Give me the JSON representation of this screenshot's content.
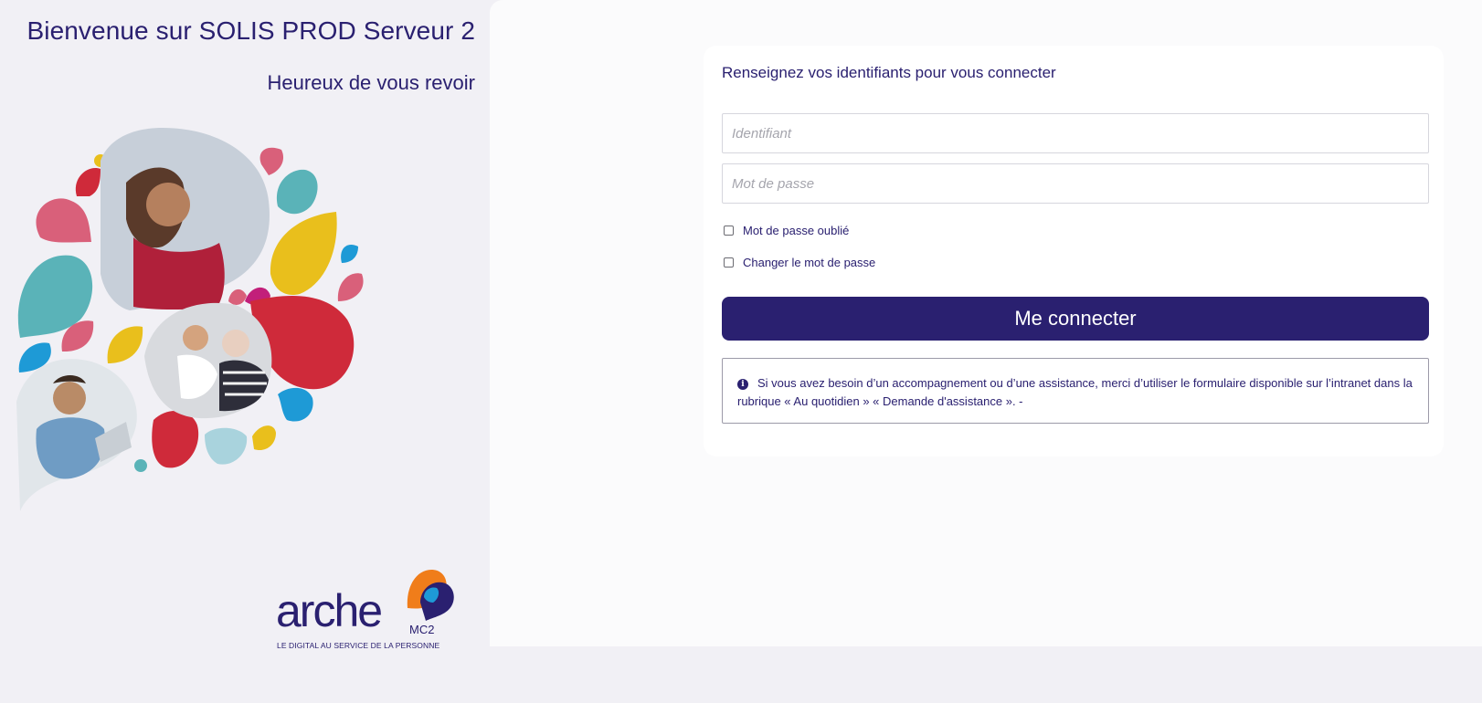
{
  "welcome": {
    "title": "Bienvenue sur SOLIS PROD Serveur 2",
    "subtitle": "Heureux de vous revoir"
  },
  "brand": {
    "logo_text": "arche",
    "logo_suffix": "MC2",
    "tagline": "LE DIGITAL AU SERVICE DE LA PERSONNE",
    "colors": {
      "primary": "#2a2070",
      "orange": "#f07d1a",
      "blue": "#1e9ad6",
      "red": "#cf2a3a",
      "pink": "#d9607a",
      "teal": "#5ab3b8",
      "yellow": "#e9bf1c"
    }
  },
  "login": {
    "heading": "Renseignez vos identifiants pour vous connecter",
    "username_placeholder": "Identifiant",
    "password_placeholder": "Mot de passe",
    "forgot_password_label": "Mot de passe oublié",
    "change_password_label": "Changer le mot de passe",
    "submit_label": "Me connecter",
    "info_icon": "info-circle-icon",
    "info_text": "Si vous avez besoin d’un accompagnement ou d’une assistance, merci d’utiliser le formulaire disponible sur l’intranet dans la rubrique « Au quotidien » « Demande d'assistance ». -"
  }
}
